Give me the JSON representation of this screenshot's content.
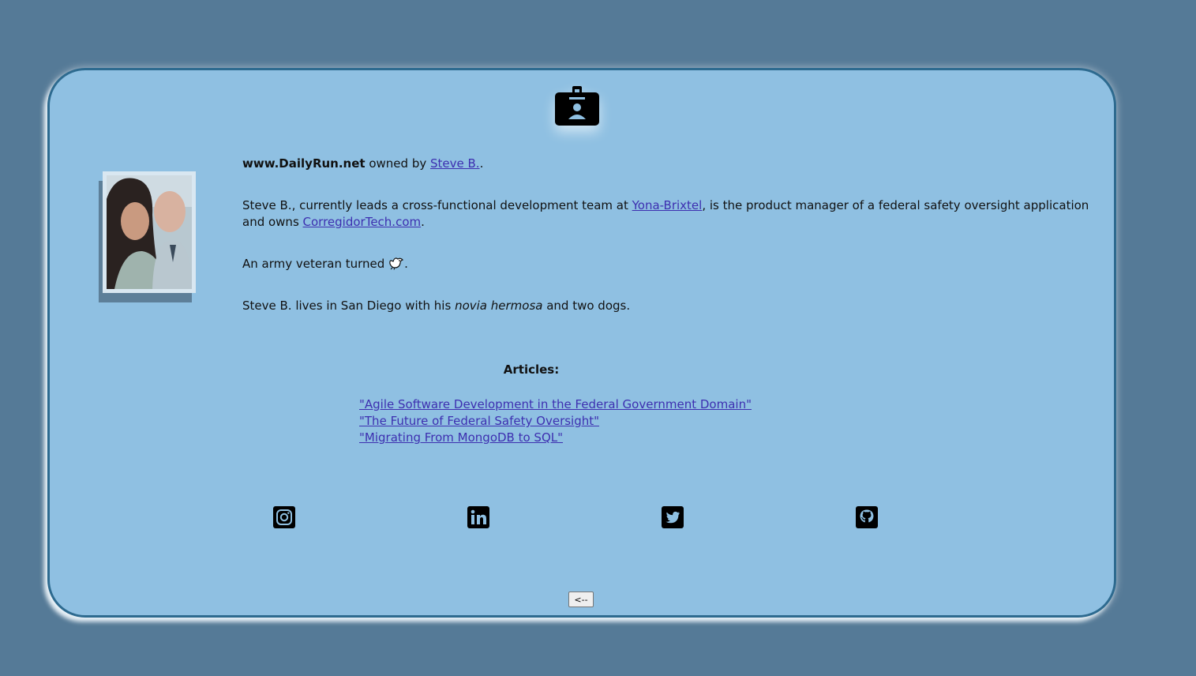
{
  "header": {
    "badge_icon": "id-badge-icon"
  },
  "about": {
    "site_name": "www.DailyRun.net",
    "owned_by_text": " owned by ",
    "owner_link": "Steve B.",
    "owner_suffix": ".",
    "p2_prefix": "Steve B., currently leads a cross-functional development team at ",
    "company_link": "Yona-Brixtel",
    "p2_middle": ", is the product manager of a federal safety oversight application and owns ",
    "corregidor_link": "CorregidorTech.com",
    "p2_suffix": ".",
    "p3_prefix": "An army veteran turned ",
    "p3_icon": "dove-icon",
    "p3_suffix": ".",
    "p4_prefix": "Steve B. lives in San Diego with his ",
    "p4_italic": "novia hermosa",
    "p4_suffix": " and two dogs."
  },
  "articles": {
    "title": "Articles:",
    "items": [
      "\"Agile Software Development in the Federal Government Domain\"",
      "\"The Future of Federal Safety Oversight\"",
      "\"Migrating From MongoDB to SQL\""
    ]
  },
  "social": {
    "icons": [
      "instagram-icon",
      "linkedin-icon",
      "twitter-icon",
      "github-icon"
    ]
  },
  "footer": {
    "back_label": "<--"
  },
  "colors": {
    "page_bg": "#557a97",
    "card_bg": "#8fc0e2",
    "card_border": "#2d6a8f",
    "link": "#3d2fb0"
  }
}
